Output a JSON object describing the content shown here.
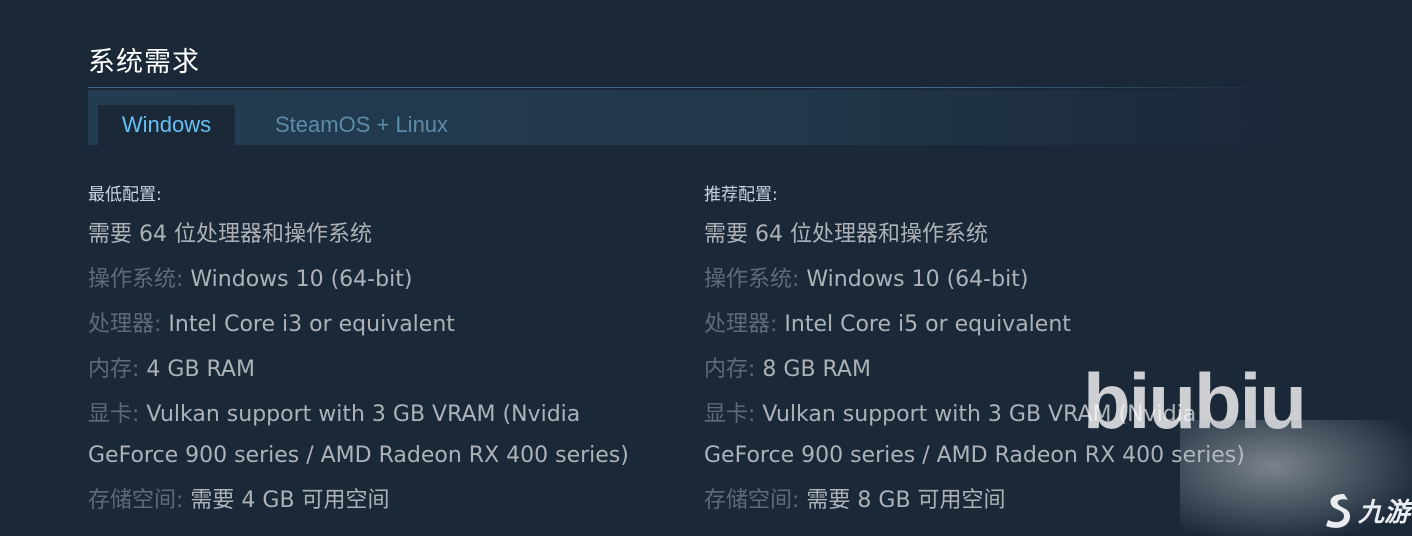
{
  "section_title": "系统需求",
  "tabs": [
    {
      "label": "Windows",
      "active": true
    },
    {
      "label": "SteamOS + Linux",
      "active": false
    }
  ],
  "minimum": {
    "heading": "最低配置:",
    "requirement_line": "需要 64 位处理器和操作系统",
    "specs": [
      {
        "label": "操作系统:",
        "value": " Windows 10 (64-bit)"
      },
      {
        "label": "处理器:",
        "value": " Intel Core i3 or equivalent"
      },
      {
        "label": "内存:",
        "value": " 4 GB RAM"
      },
      {
        "label": "显卡:",
        "value": " Vulkan support with 3 GB VRAM (Nvidia GeForce 900 series / AMD Radeon RX 400 series)"
      },
      {
        "label": "存储空间:",
        "value": " 需要 4 GB 可用空间"
      }
    ]
  },
  "recommended": {
    "heading": "推荐配置:",
    "requirement_line": "需要 64 位处理器和操作系统",
    "specs": [
      {
        "label": "操作系统:",
        "value": " Windows 10 (64-bit)"
      },
      {
        "label": "处理器:",
        "value": " Intel Core i5 or equivalent"
      },
      {
        "label": "内存:",
        "value": " 8 GB RAM"
      },
      {
        "label": "显卡:",
        "value": " Vulkan support with 3 GB VRAM (Nvidia GeForce 900 series / AMD Radeon RX 400 series)"
      },
      {
        "label": "存储空间:",
        "value": " 需要 8 GB 可用空间"
      }
    ]
  },
  "watermark": {
    "text": "biubiu",
    "logo_text": "九游"
  },
  "colors": {
    "background": "#1b2838",
    "active_tab_text": "#66c0f4",
    "inactive_tab_text": "#5d8ba8",
    "label": "#5e6a76",
    "value": "#acb2b8",
    "title": "#ffffff"
  }
}
